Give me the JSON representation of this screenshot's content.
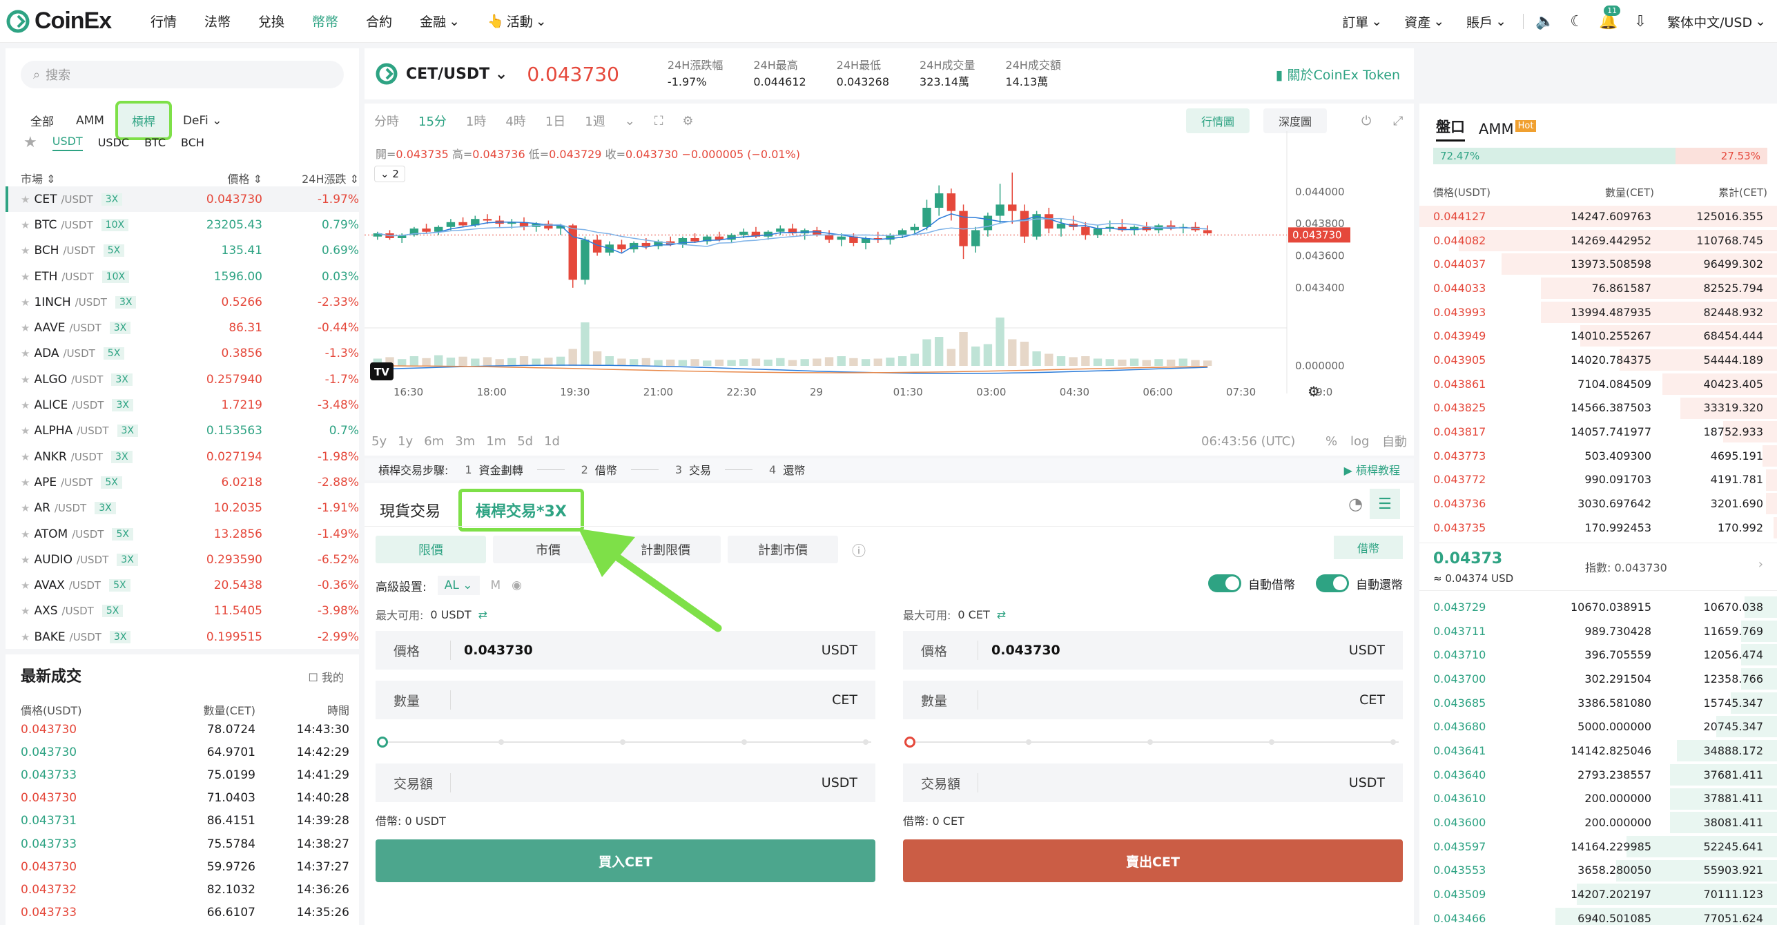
{
  "header": {
    "logo_text": "CoinEx",
    "nav": [
      "行情",
      "法幣",
      "兌換",
      "幣幣",
      "合約",
      "金融",
      "活動"
    ],
    "nav_active_index": 3,
    "right": [
      "訂單",
      "資產",
      "賬戶"
    ],
    "notification_count": "11",
    "lang": "繁体中文/USD"
  },
  "left": {
    "search_placeholder": "搜索",
    "market_tabs": [
      "全部",
      "AMM",
      "槓桿",
      "DeFi"
    ],
    "quote_tabs": [
      "USDT",
      "USDC",
      "BTC",
      "BCH"
    ],
    "head": {
      "market": "市場",
      "price": "價格",
      "change": "24H漲跌"
    },
    "markets": [
      {
        "base": "CET",
        "quote": "/USDT",
        "lev": "3X",
        "price": "0.043730",
        "change": "-1.97%",
        "dir": "down"
      },
      {
        "base": "BTC",
        "quote": "/USDT",
        "lev": "10X",
        "price": "23205.43",
        "change": "0.79%",
        "dir": "up"
      },
      {
        "base": "BCH",
        "quote": "/USDT",
        "lev": "5X",
        "price": "135.41",
        "change": "0.69%",
        "dir": "up"
      },
      {
        "base": "ETH",
        "quote": "/USDT",
        "lev": "10X",
        "price": "1596.00",
        "change": "0.03%",
        "dir": "up"
      },
      {
        "base": "1INCH",
        "quote": "/USDT",
        "lev": "3X",
        "price": "0.5266",
        "change": "-2.33%",
        "dir": "down"
      },
      {
        "base": "AAVE",
        "quote": "/USDT",
        "lev": "3X",
        "price": "86.31",
        "change": "-0.44%",
        "dir": "down"
      },
      {
        "base": "ADA",
        "quote": "/USDT",
        "lev": "5X",
        "price": "0.3856",
        "change": "-1.3%",
        "dir": "down"
      },
      {
        "base": "ALGO",
        "quote": "/USDT",
        "lev": "3X",
        "price": "0.257940",
        "change": "-1.7%",
        "dir": "down"
      },
      {
        "base": "ALICE",
        "quote": "/USDT",
        "lev": "3X",
        "price": "1.7219",
        "change": "-3.48%",
        "dir": "down"
      },
      {
        "base": "ALPHA",
        "quote": "/USDT",
        "lev": "3X",
        "price": "0.153563",
        "change": "0.7%",
        "dir": "up"
      },
      {
        "base": "ANKR",
        "quote": "/USDT",
        "lev": "3X",
        "price": "0.027194",
        "change": "-1.98%",
        "dir": "down"
      },
      {
        "base": "APE",
        "quote": "/USDT",
        "lev": "5X",
        "price": "6.0218",
        "change": "-2.88%",
        "dir": "down"
      },
      {
        "base": "AR",
        "quote": "/USDT",
        "lev": "3X",
        "price": "10.2035",
        "change": "-1.91%",
        "dir": "down"
      },
      {
        "base": "ATOM",
        "quote": "/USDT",
        "lev": "5X",
        "price": "13.2856",
        "change": "-1.49%",
        "dir": "down"
      },
      {
        "base": "AUDIO",
        "quote": "/USDT",
        "lev": "3X",
        "price": "0.293590",
        "change": "-6.52%",
        "dir": "down"
      },
      {
        "base": "AVAX",
        "quote": "/USDT",
        "lev": "5X",
        "price": "20.5438",
        "change": "-0.36%",
        "dir": "down"
      },
      {
        "base": "AXS",
        "quote": "/USDT",
        "lev": "5X",
        "price": "11.5405",
        "change": "-3.98%",
        "dir": "down"
      },
      {
        "base": "BAKE",
        "quote": "/USDT",
        "lev": "3X",
        "price": "0.199515",
        "change": "-2.99%",
        "dir": "down"
      }
    ]
  },
  "trades": {
    "title": "最新成交",
    "mine": "我的",
    "head": {
      "price": "價格(USDT)",
      "amount": "數量(CET)",
      "time": "時間"
    },
    "rows": [
      {
        "price": "0.043730",
        "amount": "78.0724",
        "time": "14:43:30",
        "dir": "down"
      },
      {
        "price": "0.043730",
        "amount": "64.9701",
        "time": "14:42:29",
        "dir": "up"
      },
      {
        "price": "0.043733",
        "amount": "75.0199",
        "time": "14:41:29",
        "dir": "up"
      },
      {
        "price": "0.043730",
        "amount": "71.0403",
        "time": "14:40:28",
        "dir": "down"
      },
      {
        "price": "0.043731",
        "amount": "86.4151",
        "time": "14:39:28",
        "dir": "up"
      },
      {
        "price": "0.043733",
        "amount": "75.5784",
        "time": "14:38:27",
        "dir": "up"
      },
      {
        "price": "0.043730",
        "amount": "59.9726",
        "time": "14:37:27",
        "dir": "down"
      },
      {
        "price": "0.043732",
        "amount": "82.1032",
        "time": "14:36:26",
        "dir": "down"
      },
      {
        "price": "0.043733",
        "amount": "66.6107",
        "time": "14:35:26",
        "dir": "down"
      }
    ]
  },
  "ticker": {
    "pair": "CET/USDT",
    "price": "0.043730",
    "stats": [
      {
        "label": "24H漲跌幅",
        "value": "-1.97%"
      },
      {
        "label": "24H最高",
        "value": "0.044612"
      },
      {
        "label": "24H最低",
        "value": "0.043268"
      },
      {
        "label": "24H成交量",
        "value": "323.14萬"
      },
      {
        "label": "24H成交額",
        "value": "14.13萬"
      }
    ],
    "cet_link": "關於CoinEx Token"
  },
  "chart": {
    "intervals": [
      "分時",
      "15分",
      "1時",
      "4時",
      "1日",
      "1週"
    ],
    "active_interval": 1,
    "views": [
      "行情圖",
      "深度圖"
    ],
    "ohlc": {
      "open_l": "開=",
      "open": "0.043735",
      "high_l": "高=",
      "high": "0.043736",
      "low_l": "低=",
      "low": "0.043729",
      "close_l": "收=",
      "close": "0.043730",
      "chg": "−0.000005 (−0.01%)"
    },
    "collapse": "2",
    "ranges": [
      "5y",
      "1y",
      "6m",
      "3m",
      "1m",
      "5d",
      "1d"
    ],
    "clock": "06:43:56 (UTC)",
    "opts": [
      "%",
      "log",
      "自動"
    ],
    "yticks": [
      "0.044000",
      "0.043800",
      "0.043600",
      "0.043400",
      "0.000000"
    ],
    "last_label": "0.043730",
    "xticks": [
      "16:30",
      "18:00",
      "19:30",
      "21:00",
      "22:30",
      "29",
      "01:30",
      "03:00",
      "04:30",
      "06:00",
      "07:30",
      "09:0"
    ]
  },
  "chart_data": {
    "type": "candlestick",
    "interval": "15分",
    "ylim": [
      0.0433,
      0.04412
    ],
    "candles": [
      [
        0.04372,
        0.04375,
        0.0437,
        0.04374
      ],
      [
        0.04374,
        0.04376,
        0.0437,
        0.04371
      ],
      [
        0.04371,
        0.04374,
        0.04368,
        0.04373
      ],
      [
        0.04373,
        0.04378,
        0.04372,
        0.04377
      ],
      [
        0.04377,
        0.0438,
        0.04374,
        0.04375
      ],
      [
        0.04375,
        0.04379,
        0.04373,
        0.04378
      ],
      [
        0.04378,
        0.04383,
        0.04376,
        0.04381
      ],
      [
        0.04381,
        0.04384,
        0.04378,
        0.04379
      ],
      [
        0.04379,
        0.04385,
        0.04378,
        0.04383
      ],
      [
        0.04383,
        0.04386,
        0.0438,
        0.04382
      ],
      [
        0.04382,
        0.04385,
        0.04378,
        0.0438
      ],
      [
        0.0438,
        0.04383,
        0.04377,
        0.04381
      ],
      [
        0.04381,
        0.04384,
        0.04376,
        0.04378
      ],
      [
        0.04378,
        0.04381,
        0.04375,
        0.0438
      ],
      [
        0.0438,
        0.04382,
        0.04376,
        0.04377
      ],
      [
        0.04377,
        0.0438,
        0.04373,
        0.04379
      ],
      [
        0.04379,
        0.0438,
        0.0434,
        0.04345
      ],
      [
        0.04345,
        0.04372,
        0.04342,
        0.0437
      ],
      [
        0.0437,
        0.04373,
        0.0436,
        0.04362
      ],
      [
        0.04362,
        0.04369,
        0.0436,
        0.04367
      ],
      [
        0.04367,
        0.0437,
        0.04362,
        0.04364
      ],
      [
        0.04364,
        0.04369,
        0.04362,
        0.04368
      ],
      [
        0.04368,
        0.04371,
        0.04364,
        0.04366
      ],
      [
        0.04366,
        0.0437,
        0.04364,
        0.04369
      ],
      [
        0.04369,
        0.04372,
        0.04366,
        0.04367
      ],
      [
        0.04367,
        0.04372,
        0.04365,
        0.04371
      ],
      [
        0.04371,
        0.04374,
        0.04368,
        0.04369
      ],
      [
        0.04369,
        0.04373,
        0.04367,
        0.04372
      ],
      [
        0.04372,
        0.04375,
        0.04369,
        0.0437
      ],
      [
        0.0437,
        0.04374,
        0.04368,
        0.04373
      ],
      [
        0.04373,
        0.04377,
        0.04371,
        0.04375
      ],
      [
        0.04375,
        0.04378,
        0.04371,
        0.04372
      ],
      [
        0.04372,
        0.04376,
        0.0437,
        0.04375
      ],
      [
        0.04375,
        0.04379,
        0.04373,
        0.04377
      ],
      [
        0.04377,
        0.0438,
        0.04373,
        0.04374
      ],
      [
        0.04374,
        0.04377,
        0.0437,
        0.04376
      ],
      [
        0.04376,
        0.04378,
        0.04372,
        0.04373
      ],
      [
        0.04373,
        0.04376,
        0.04368,
        0.0437
      ],
      [
        0.0437,
        0.04374,
        0.04366,
        0.04372
      ],
      [
        0.04372,
        0.04374,
        0.04366,
        0.04368
      ],
      [
        0.04368,
        0.04372,
        0.04364,
        0.04371
      ],
      [
        0.04371,
        0.04375,
        0.04368,
        0.0437
      ],
      [
        0.0437,
        0.04374,
        0.04367,
        0.04373
      ],
      [
        0.04373,
        0.04377,
        0.04371,
        0.04376
      ],
      [
        0.04376,
        0.0438,
        0.04374,
        0.04378
      ],
      [
        0.04378,
        0.04395,
        0.04376,
        0.0439
      ],
      [
        0.0439,
        0.04404,
        0.04385,
        0.04399
      ],
      [
        0.04399,
        0.04402,
        0.04382,
        0.04388
      ],
      [
        0.04388,
        0.04392,
        0.04358,
        0.04366
      ],
      [
        0.04366,
        0.04378,
        0.04362,
        0.04376
      ],
      [
        0.04376,
        0.04387,
        0.04372,
        0.04385
      ],
      [
        0.04385,
        0.04405,
        0.0438,
        0.04392
      ],
      [
        0.04392,
        0.04412,
        0.0438,
        0.04388
      ],
      [
        0.04388,
        0.04392,
        0.04368,
        0.04372
      ],
      [
        0.04372,
        0.04388,
        0.0437,
        0.04386
      ],
      [
        0.04386,
        0.0439,
        0.04374,
        0.04377
      ],
      [
        0.04377,
        0.04383,
        0.04372,
        0.0438
      ],
      [
        0.0438,
        0.04385,
        0.04376,
        0.04378
      ],
      [
        0.04378,
        0.04381,
        0.0437,
        0.04373
      ],
      [
        0.04373,
        0.04379,
        0.04371,
        0.04377
      ],
      [
        0.04377,
        0.04382,
        0.04375,
        0.04378
      ],
      [
        0.04378,
        0.04383,
        0.04375,
        0.04376
      ],
      [
        0.04376,
        0.04379,
        0.04373,
        0.04378
      ],
      [
        0.04378,
        0.04381,
        0.04375,
        0.04376
      ],
      [
        0.04376,
        0.0438,
        0.04374,
        0.04379
      ],
      [
        0.04379,
        0.04382,
        0.04376,
        0.04377
      ],
      [
        0.04377,
        0.0438,
        0.04374,
        0.04378
      ],
      [
        0.04378,
        0.04381,
        0.04375,
        0.04376
      ],
      [
        0.04376,
        0.04379,
        0.04373,
        0.04374
      ]
    ],
    "volumes": [
      0.15,
      0.18,
      0.14,
      0.2,
      0.16,
      0.22,
      0.17,
      0.19,
      0.15,
      0.18,
      0.14,
      0.16,
      0.2,
      0.15,
      0.17,
      0.19,
      0.35,
      0.9,
      0.3,
      0.2,
      0.15,
      0.14,
      0.16,
      0.12,
      0.13,
      0.12,
      0.14,
      0.11,
      0.13,
      0.12,
      0.14,
      0.15,
      0.13,
      0.16,
      0.12,
      0.14,
      0.15,
      0.18,
      0.2,
      0.16,
      0.14,
      0.15,
      0.17,
      0.2,
      0.25,
      0.55,
      0.6,
      0.35,
      0.7,
      0.4,
      0.45,
      1.0,
      0.55,
      0.5,
      0.3,
      0.25,
      0.2,
      0.18,
      0.2,
      0.15,
      0.14,
      0.13,
      0.15,
      0.12,
      0.14,
      0.13,
      0.15,
      0.12,
      0.11
    ]
  },
  "steps": {
    "label": "槓桿交易步驟:",
    "items": [
      {
        "n": "1",
        "t": "資金劃轉"
      },
      {
        "n": "2",
        "t": "借幣"
      },
      {
        "n": "3",
        "t": "交易"
      },
      {
        "n": "4",
        "t": "還幣"
      }
    ],
    "tutorial": "槓桿教程"
  },
  "trade": {
    "tabs": [
      "現貨交易",
      "槓桿交易*3X"
    ],
    "order_types": [
      "限價",
      "市價",
      "計劃限價",
      "計劃市價"
    ],
    "borrow_button": "借幣",
    "adv_label": "高級設置:",
    "adv_select": "AL",
    "adv_m": "M",
    "auto_borrow": "自動借幣",
    "auto_repay": "自動還幣",
    "buy": {
      "avail_label": "最大可用:",
      "avail": "0 USDT",
      "price_label": "價格",
      "price": "0.043730",
      "price_unit": "USDT",
      "qty_label": "數量",
      "qty_unit": "CET",
      "amt_label": "交易額",
      "amt_unit": "USDT",
      "borrow_label": "借幣:",
      "borrow": "0 USDT",
      "button": "買入CET"
    },
    "sell": {
      "avail_label": "最大可用:",
      "avail": "0 CET",
      "price_label": "價格",
      "price": "0.043730",
      "price_unit": "USDT",
      "qty_label": "數量",
      "qty_unit": "CET",
      "amt_label": "交易額",
      "amt_unit": "USDT",
      "borrow_label": "借幣:",
      "borrow": "0 CET",
      "button": "賣出CET"
    }
  },
  "orderbook": {
    "tabs": [
      "盤口",
      "AMM"
    ],
    "hot": "Hot",
    "buy_ratio": "72.47%",
    "sell_ratio": "27.53%",
    "head": {
      "price": "價格(USDT)",
      "amount": "數量(CET)",
      "total": "累計(CET)"
    },
    "asks": [
      {
        "p": "0.044127",
        "a": "14247.609763",
        "t": "125016.355",
        "d": 1.0
      },
      {
        "p": "0.044082",
        "a": "14269.442952",
        "t": "110768.745",
        "d": 0.89
      },
      {
        "p": "0.044037",
        "a": "13973.508598",
        "t": "96499.302",
        "d": 0.77
      },
      {
        "p": "0.044033",
        "a": "76.861587",
        "t": "82525.794",
        "d": 0.66
      },
      {
        "p": "0.043993",
        "a": "13994.487935",
        "t": "82448.932",
        "d": 0.66
      },
      {
        "p": "0.043949",
        "a": "14010.255267",
        "t": "68454.444",
        "d": 0.55
      },
      {
        "p": "0.043905",
        "a": "14020.784375",
        "t": "54444.189",
        "d": 0.44
      },
      {
        "p": "0.043861",
        "a": "7104.084509",
        "t": "40423.405",
        "d": 0.32
      },
      {
        "p": "0.043825",
        "a": "14566.387503",
        "t": "33319.320",
        "d": 0.27
      },
      {
        "p": "0.043817",
        "a": "14057.741977",
        "t": "18752.933",
        "d": 0.15
      },
      {
        "p": "0.043773",
        "a": "503.409300",
        "t": "4695.191",
        "d": 0.04
      },
      {
        "p": "0.043772",
        "a": "990.091703",
        "t": "4191.781",
        "d": 0.03
      },
      {
        "p": "0.043736",
        "a": "3030.697642",
        "t": "3201.690",
        "d": 0.03
      },
      {
        "p": "0.043735",
        "a": "170.992453",
        "t": "170.992",
        "d": 0.01
      }
    ],
    "mid_price": "0.04373",
    "mid_usd": "≈ 0.04374 USD",
    "index_label": "指數:",
    "index": "0.043730",
    "bids": [
      {
        "p": "0.043729",
        "a": "10670.038915",
        "t": "10670.038",
        "d": 0.09
      },
      {
        "p": "0.043711",
        "a": "989.730428",
        "t": "11659.769",
        "d": 0.1
      },
      {
        "p": "0.043710",
        "a": "396.705559",
        "t": "12056.474",
        "d": 0.1
      },
      {
        "p": "0.043700",
        "a": "302.291504",
        "t": "12358.766",
        "d": 0.1
      },
      {
        "p": "0.043685",
        "a": "3386.581080",
        "t": "15745.347",
        "d": 0.13
      },
      {
        "p": "0.043680",
        "a": "5000.000000",
        "t": "20745.347",
        "d": 0.17
      },
      {
        "p": "0.043641",
        "a": "14142.825046",
        "t": "34888.172",
        "d": 0.28
      },
      {
        "p": "0.043640",
        "a": "2793.238557",
        "t": "37681.411",
        "d": 0.3
      },
      {
        "p": "0.043610",
        "a": "200.000000",
        "t": "37881.411",
        "d": 0.3
      },
      {
        "p": "0.043600",
        "a": "200.000000",
        "t": "38081.411",
        "d": 0.3
      },
      {
        "p": "0.043597",
        "a": "14164.229985",
        "t": "52245.641",
        "d": 0.42
      },
      {
        "p": "0.043553",
        "a": "3658.280050",
        "t": "55903.921",
        "d": 0.45
      },
      {
        "p": "0.043509",
        "a": "14207.202197",
        "t": "70111.123",
        "d": 0.56
      },
      {
        "p": "0.043466",
        "a": "6940.501085",
        "t": "77051.624",
        "d": 0.62
      }
    ]
  },
  "colors": {
    "green": "#2ea383",
    "red": "#e5483b",
    "highlight": "#7ee048"
  }
}
